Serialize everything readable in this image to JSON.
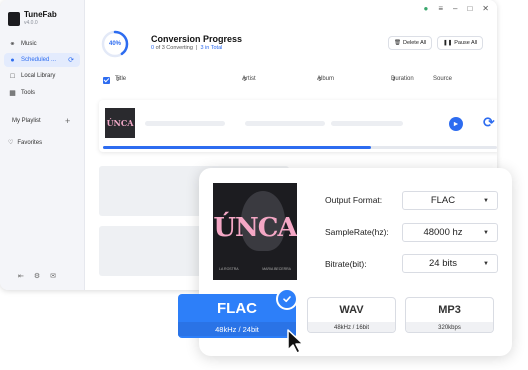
{
  "app": {
    "name": "TuneFab",
    "version": "v4.0.0"
  },
  "sidebar": {
    "items": [
      {
        "label": "Music",
        "icon": "headphones-icon"
      },
      {
        "label": "Scheduled ...",
        "icon": "clock-icon",
        "status": "syncing-icon"
      },
      {
        "label": "Local Library",
        "icon": "folder-icon"
      },
      {
        "label": "Tools",
        "icon": "grid-icon"
      }
    ],
    "playlist_label": "My Playlist",
    "favorites_label": "Favorites"
  },
  "progress": {
    "percent_label": "40%",
    "percent": 0.4,
    "title": "Conversion Progress",
    "converting_count": "0",
    "converting_text": "of 3 Converting",
    "total_text": "3 in Total"
  },
  "toolbar": {
    "delete_all": "Delete All",
    "pause_all": "Pause All"
  },
  "table": {
    "columns": [
      "Title",
      "Artist",
      "Album",
      "Duration",
      "Source"
    ],
    "row_progress": 0.68,
    "thumb_text": "ÚNCA"
  },
  "settings": {
    "album_art_text": "ÚNCA",
    "album_art_small_left": "LA ROSTRA",
    "album_art_small_right": "MARIA BECERRA",
    "output_format_label": "Output Format:",
    "output_format_value": "FLAC",
    "samplerate_label": "SampleRate(hz):",
    "samplerate_value": "48000 hz",
    "bitrate_label": "Bitrate(bit):",
    "bitrate_value": "24 bits"
  },
  "formats": [
    {
      "name": "FLAC",
      "detail": "48kHz / 24bit",
      "selected": true
    },
    {
      "name": "WAV",
      "detail": "48kHz / 16bit",
      "selected": false
    },
    {
      "name": "MP3",
      "detail": "320kbps",
      "selected": false
    }
  ],
  "colors": {
    "accent": "#2d6cf0",
    "flac_selected": "#2d7ff9",
    "album_text": "#f4a7c5"
  }
}
